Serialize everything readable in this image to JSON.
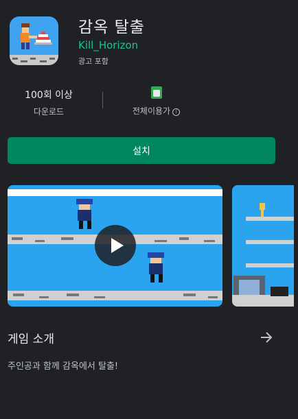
{
  "app": {
    "title": "감옥 탈출",
    "developer": "Kill_Horizon",
    "ads_label": "광고 포함"
  },
  "stats": {
    "downloads_value": "100회 이상",
    "downloads_label": "다운로드",
    "rating_label": "전체이용가",
    "rating_badge_icon": "content-rating-badge-icon",
    "info_icon": "info-icon"
  },
  "install": {
    "label": "설치"
  },
  "screenshots": {
    "play_icon": "play-icon"
  },
  "about": {
    "title": "게임 소개",
    "arrow_icon": "arrow-right-icon",
    "description": "주인공과 함께 감옥에서 탈출!"
  },
  "colors": {
    "background": "#202124",
    "accent": "#01875f",
    "developer": "#19c59a",
    "screenshot_sky": "#2aa4ef"
  }
}
